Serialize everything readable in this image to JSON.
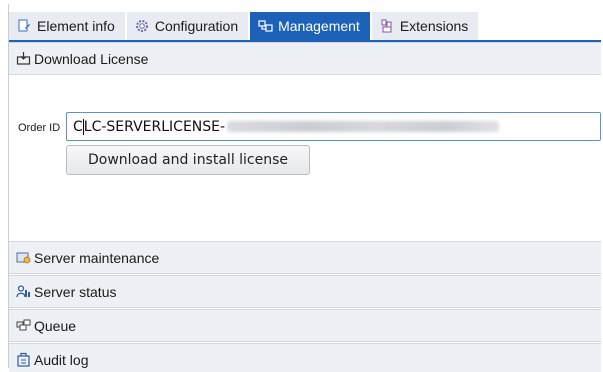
{
  "tabs": [
    {
      "label": "Element info",
      "icon": "document-edit-icon"
    },
    {
      "label": "Configuration",
      "icon": "gear-icon"
    },
    {
      "label": "Management",
      "icon": "management-icon"
    },
    {
      "label": "Extensions",
      "icon": "extensions-icon"
    }
  ],
  "active_tab": "Management",
  "download_section": {
    "title": "Download License",
    "icon": "download-license-icon",
    "order_id_label": "Order ID",
    "order_id_value": "CLC-SERVERLICENSE-",
    "download_button": "Download and install license"
  },
  "sections": [
    {
      "title": "Server maintenance",
      "icon": "server-maintenance-icon"
    },
    {
      "title": "Server status",
      "icon": "server-status-icon"
    },
    {
      "title": "Queue",
      "icon": "queue-icon"
    },
    {
      "title": "Audit log",
      "icon": "audit-log-icon"
    }
  ],
  "colors": {
    "accent": "#1c62b9",
    "section_bg": "#edf0f5",
    "tab_bg": "#e8ecf2"
  }
}
